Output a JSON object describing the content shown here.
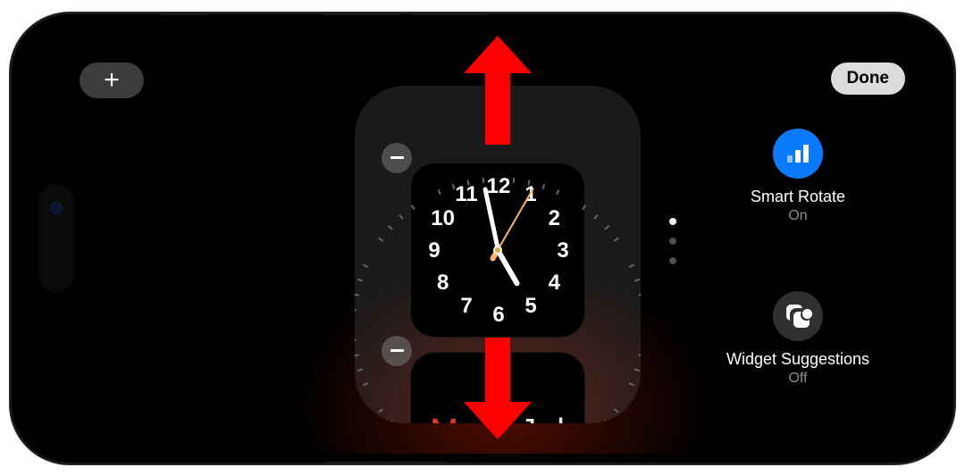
{
  "toolbar": {
    "add_label": "+",
    "done_label": "Done"
  },
  "widgets": {
    "clock": {
      "numbers": [
        "12",
        "1",
        "2",
        "3",
        "4",
        "5",
        "6",
        "7",
        "8",
        "9",
        "10",
        "11"
      ],
      "hour_angle": 150,
      "minute_angle": 348,
      "second_angle": 30
    },
    "calendar": {
      "day_abbrev": "Mo",
      "rest": "n, Jul"
    }
  },
  "pager": {
    "count": 3,
    "active": 0
  },
  "options": {
    "smart_rotate": {
      "title": "Smart Rotate",
      "status": "On"
    },
    "widget_suggestions": {
      "title": "Widget Suggestions",
      "status": "Off"
    }
  }
}
